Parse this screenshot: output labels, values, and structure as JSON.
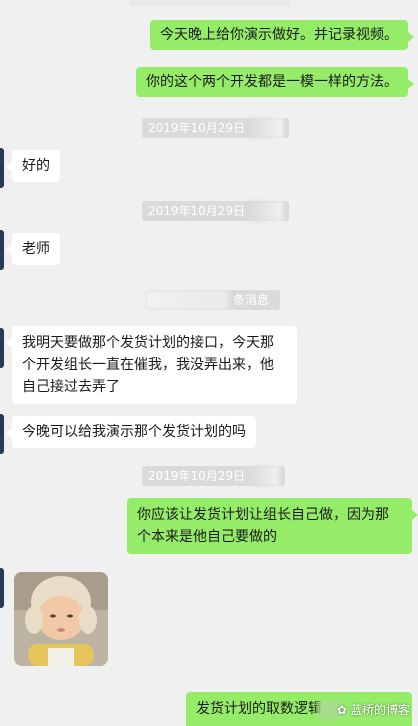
{
  "messages": [
    {
      "text": "今天晚上给你演示做好。并记录视频。"
    },
    {
      "text": "你的这个两个开发都是一模一样的方法。"
    },
    {
      "text": "好的"
    },
    {
      "text": "老师"
    },
    {
      "text": "我明天要做那个发货计划的接口，今天那个开发组长一直在催我，我没弄出来，他自己接过去弄了"
    },
    {
      "text": "今晚可以给我演示那个发货计划的吗"
    },
    {
      "text": "你应该让发货计划让组长自己做，因为那个本来是他自己要做的"
    },
    {
      "text": "发货计划的取数逻辑"
    }
  ],
  "timestamps": [
    {
      "text": "2019年10月29日"
    },
    {
      "text": "2019年10月29日"
    },
    {
      "text": "2019年10月29日"
    }
  ],
  "system_notice": {
    "text": "条消息"
  },
  "watermark": {
    "text": "蓝桥的博客"
  },
  "colors": {
    "outgoing": "#95ec69",
    "incoming": "#ffffff",
    "background": "#f0f0f0"
  }
}
